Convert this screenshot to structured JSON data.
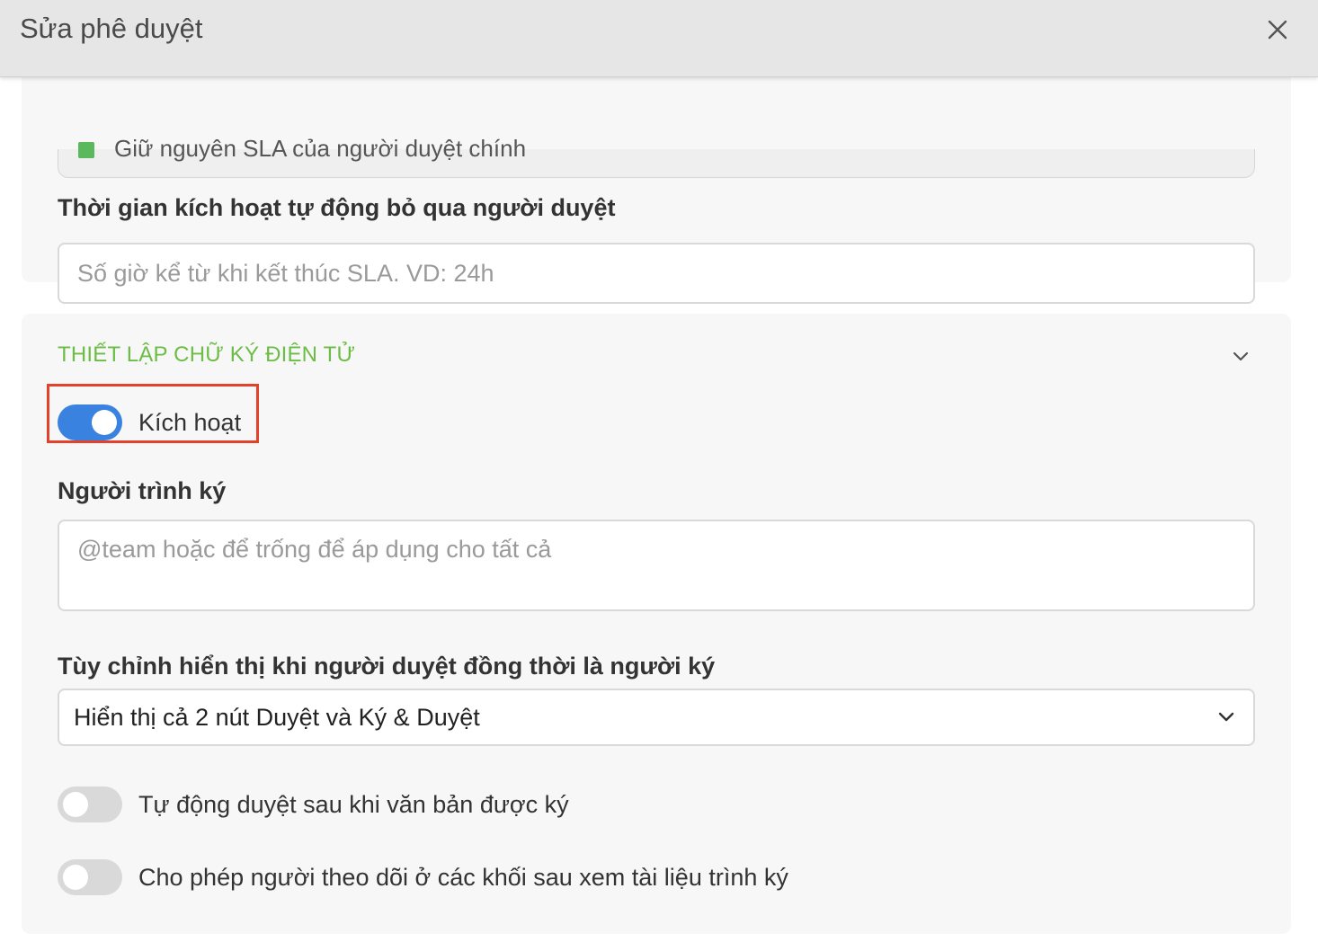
{
  "header": {
    "title": "Sửa phê duyệt"
  },
  "sla_section": {
    "keep_sla_text": "Giữ nguyên SLA của người duyệt chính",
    "auto_skip_label": "Thời gian kích hoạt tự động bỏ qua người duyệt",
    "auto_skip_placeholder": "Số giờ kể từ khi kết thúc SLA. VD: 24h"
  },
  "esign_section": {
    "title": "THIẾT LẬP CHỮ KÝ ĐIỆN TỬ",
    "activate_label": "Kích hoạt",
    "activate_on": true,
    "submitter_label": "Người trình ký",
    "submitter_placeholder": "@team hoặc để trống để áp dụng cho tất cả",
    "display_label": "Tùy chỉnh hiển thị khi người duyệt đồng thời là người ký",
    "display_value": "Hiển thị cả 2 nút Duyệt và Ký & Duyệt",
    "auto_approve_label": "Tự động duyệt sau khi văn bản được ký",
    "auto_approve_on": false,
    "followers_view_label": "Cho phép người theo dõi ở các khối sau xem tài liệu trình ký",
    "followers_view_on": false
  },
  "colors": {
    "accent_blue": "#3a82e0",
    "section_green": "#6cbd45",
    "highlight_red": "#e3412b"
  },
  "icons": {
    "close": "close-icon",
    "collapse": "chevron-down-icon",
    "select": "chevron-down-icon"
  }
}
